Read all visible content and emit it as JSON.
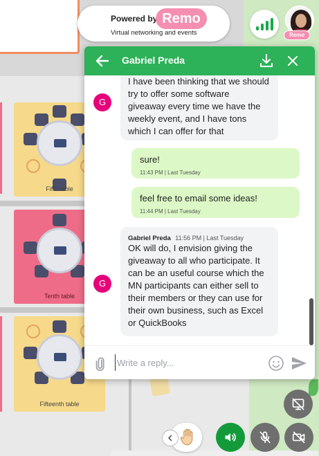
{
  "brand": {
    "powered_by": "Powered by",
    "logo_text": "Remo",
    "tagline": "Virtual networking and events",
    "avatar_badge": "Remo"
  },
  "floor": {
    "tables": [
      {
        "label": "Fifth table"
      },
      {
        "label": "Tenth table"
      },
      {
        "label": "Fifteenth table"
      }
    ]
  },
  "chat": {
    "title": "Gabriel Preda",
    "messages": [
      {
        "direction": "incoming",
        "avatar_initial": "G",
        "lines": [
          "I have been thinking that we should",
          "try to offer some software",
          "giveaway every time we have the",
          "weekly event, and I have tons",
          "which I can offer for that"
        ]
      },
      {
        "direction": "outgoing",
        "text": "sure!",
        "meta": "11:43 PM | Last Tuesday"
      },
      {
        "direction": "outgoing",
        "text": "feel free to email some ideas!",
        "meta": "11:44 PM | Last Tuesday"
      },
      {
        "direction": "incoming",
        "avatar_initial": "G",
        "sender": "Gabriel Preda",
        "meta": "11:56 PM | Last Tuesday",
        "lines": [
          "OK will do, I envision giving the",
          "giveaway to all who participate. It",
          "can be an useful course which the",
          "MN participants can either sell to",
          "their members or they can use for",
          "their own business, such as Excel",
          "or QuickBooks"
        ]
      }
    ],
    "composer": {
      "placeholder": "Write a reply..."
    }
  },
  "colors": {
    "header_green": "#2db159",
    "outgoing_bubble": "#dcf8c6",
    "incoming_bubble": "#f2f3f5",
    "avatar_magenta": "#e6007a",
    "remo_pink": "#f48fb1",
    "speaker_green": "#139b3b",
    "control_grey": "#6f6f6f"
  },
  "icons": {
    "header": [
      "arrow-left-icon",
      "download-icon",
      "close-icon"
    ],
    "composer": [
      "paperclip-icon",
      "emoji-icon",
      "send-icon"
    ],
    "controls": [
      "signal-icon",
      "screen-share-off-icon",
      "chevron-left-icon",
      "raise-hand-icon",
      "speaker-icon",
      "mic-off-icon",
      "camera-off-icon"
    ]
  }
}
